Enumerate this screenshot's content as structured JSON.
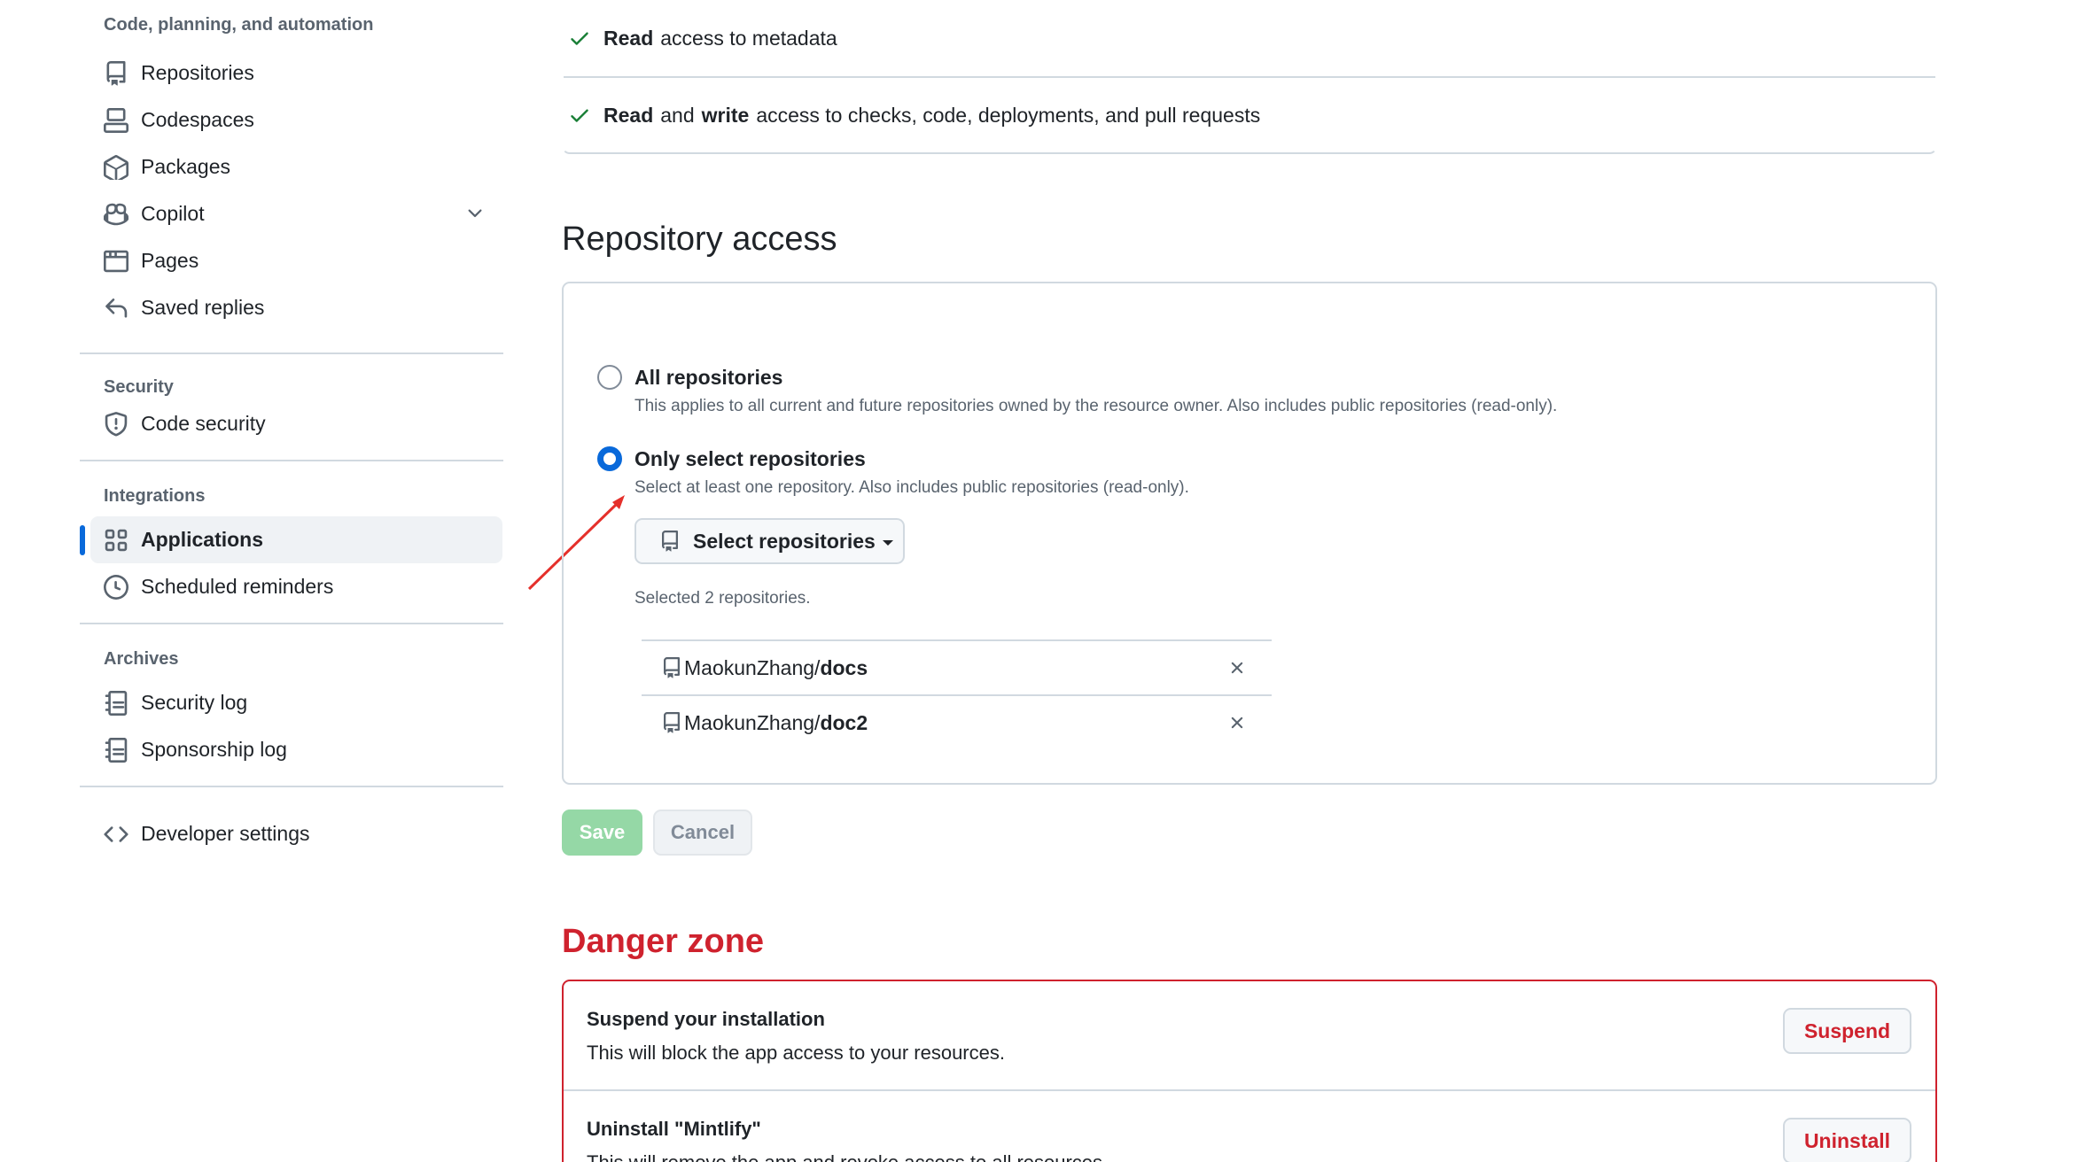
{
  "sidebar": {
    "section_code": "Code, planning, and automation",
    "items_code": [
      {
        "label": "Repositories",
        "icon": "repo-icon"
      },
      {
        "label": "Codespaces",
        "icon": "codespaces-icon"
      },
      {
        "label": "Packages",
        "icon": "package-icon"
      },
      {
        "label": "Copilot",
        "icon": "copilot-icon"
      },
      {
        "label": "Pages",
        "icon": "browser-icon"
      },
      {
        "label": "Saved replies",
        "icon": "reply-icon"
      }
    ],
    "section_security": "Security",
    "item_code_security": "Code security",
    "section_integrations": "Integrations",
    "item_applications": "Applications",
    "item_scheduled": "Scheduled reminders",
    "section_archives": "Archives",
    "item_security_log": "Security log",
    "item_sponsorship_log": "Sponsorship log",
    "item_developer": "Developer settings"
  },
  "permissions": {
    "row1": {
      "bold1": "Read",
      "rest": "access to metadata"
    },
    "row2": {
      "bold1": "Read",
      "mid": "and",
      "bold2": "write",
      "rest": "access to checks, code, deployments, and pull requests"
    }
  },
  "repo_access": {
    "title": "Repository access",
    "all": {
      "label": "All repositories",
      "desc": "This applies to all current and future repositories owned by the resource owner. Also includes public repositories (read-only)."
    },
    "select": {
      "label": "Only select repositories",
      "desc": "Select at least one repository. Also includes public repositories (read-only)."
    },
    "select_button": "Select repositories",
    "selected_count": "Selected 2 repositories.",
    "repos": [
      {
        "owner": "MaokunZhang/",
        "name": "docs"
      },
      {
        "owner": "MaokunZhang/",
        "name": "doc2"
      }
    ],
    "save": "Save",
    "cancel": "Cancel"
  },
  "danger": {
    "title": "Danger zone",
    "suspend": {
      "title": "Suspend your installation",
      "desc": "This will block the app access to your resources.",
      "button": "Suspend"
    },
    "uninstall": {
      "title": "Uninstall \"Mintlify\"",
      "desc": "This will remove the app and revoke access to all resources.",
      "button": "Uninstall"
    }
  },
  "colors": {
    "accent": "#0969da",
    "danger": "#cf222e",
    "success": "#1a7f37",
    "annotation_arrow": "#e5302b"
  }
}
